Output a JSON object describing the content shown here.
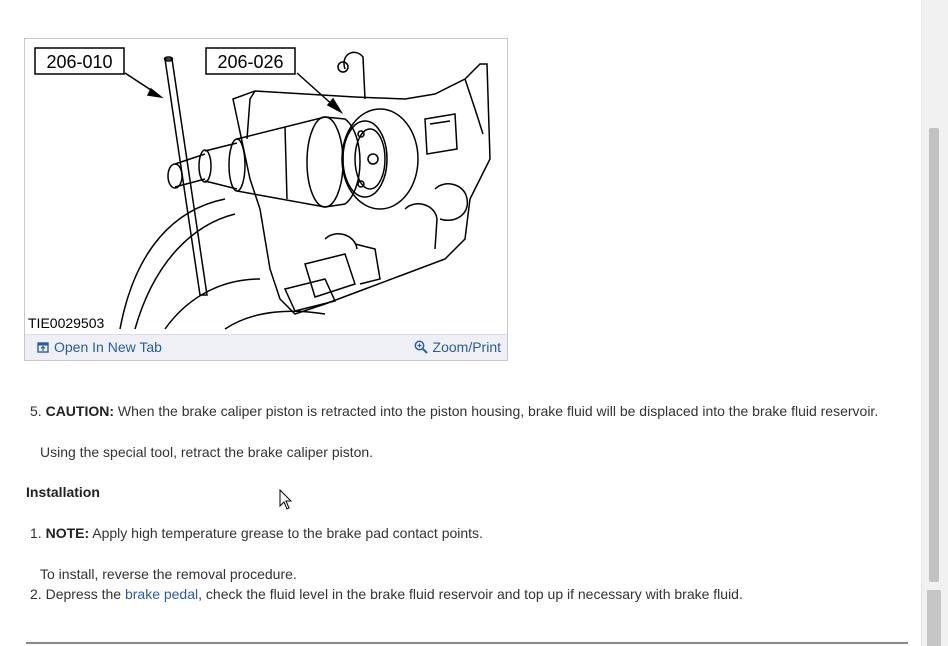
{
  "figure": {
    "callout_left": "206-010",
    "callout_right": "206-026",
    "image_id": "TIE0029503",
    "open_tab_label": "Open In New Tab",
    "zoom_label": "Zoom/Print"
  },
  "steps": {
    "step5_num": "5.",
    "step5_caution_label": "CAUTION:",
    "step5_caution_text": " When the brake caliper piston is retracted into the piston housing, brake fluid will be displaced into the brake fluid reservoir.",
    "step5_action": "Using the special tool, retract the brake caliper piston."
  },
  "installation": {
    "heading": "Installation",
    "step1_num": "1.",
    "step1_note_label": "NOTE:",
    "step1_note_text": " Apply high temperature grease to the brake pad contact points.",
    "step1_action": "To install, reverse the removal procedure.",
    "step2_num": "2.",
    "step2_pre": "Depress the ",
    "step2_link": "brake pedal",
    "step2_post": ", check the fluid level in the brake fluid reservoir and top up if necessary with brake fluid."
  },
  "colors": {
    "link": "#2a5d9f",
    "toolbar_bg": "#eef0f5"
  }
}
